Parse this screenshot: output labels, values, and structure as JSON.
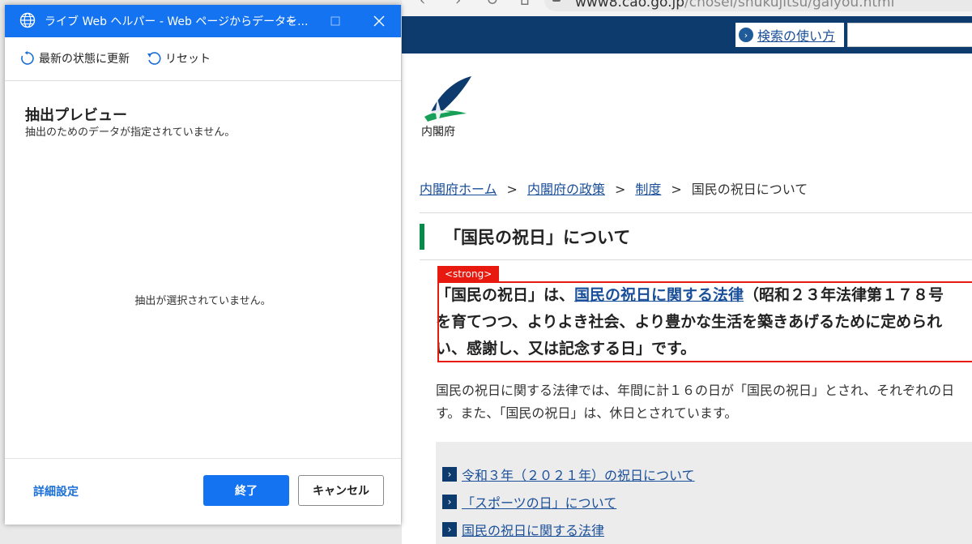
{
  "dialog": {
    "title": "ライブ Web ヘルパー - Web ページからデータを...",
    "toolbar": {
      "refresh_label": "最新の状態に更新",
      "reset_label": "リセット"
    },
    "preview_title": "抽出プレビュー",
    "preview_subtitle": "抽出のためのデータが指定されていません。",
    "empty_message": "抽出が選択されていません。",
    "advanced_link": "詳細設定",
    "finish_button": "終了",
    "cancel_button": "キャンセル",
    "accent_color": "#1473f0"
  },
  "browser": {
    "url_host": "www8.cao.go.jp",
    "url_path": "/chosei/shukujitsu/gaiyou.html",
    "search_help": "検索の使い方",
    "logo_text": "内閣府",
    "breadcrumb": {
      "home": "内閣府ホーム",
      "policy": "内閣府の政策",
      "system": "制度",
      "current": "国民の祝日について",
      "separator": ">"
    },
    "heading": "「国民の祝日」について",
    "strong_tag": "<strong>",
    "lead": {
      "part1": "「国民の祝日」は、",
      "link": "国民の祝日に関する法律",
      "part2": "（昭和２３年法律第１７８号",
      "line2": "を育てつつ、よりよき社会、より豊かな生活を築きあげるために定められ",
      "line3": "い、感謝し、又は記念する日」です。"
    },
    "paragraph": {
      "line1": "国民の祝日に関する法律では、年間に計１６の日が「国民の祝日」とされ、それぞれの日",
      "line2": "す。また、「国民の祝日」は、休日とされています。"
    },
    "links": [
      "令和３年（２０２１年）の祝日について",
      "「スポーツの日」について",
      "国民の祝日に関する法律"
    ],
    "header_color": "#0e3b6e",
    "highlight_color": "#e8190f"
  }
}
